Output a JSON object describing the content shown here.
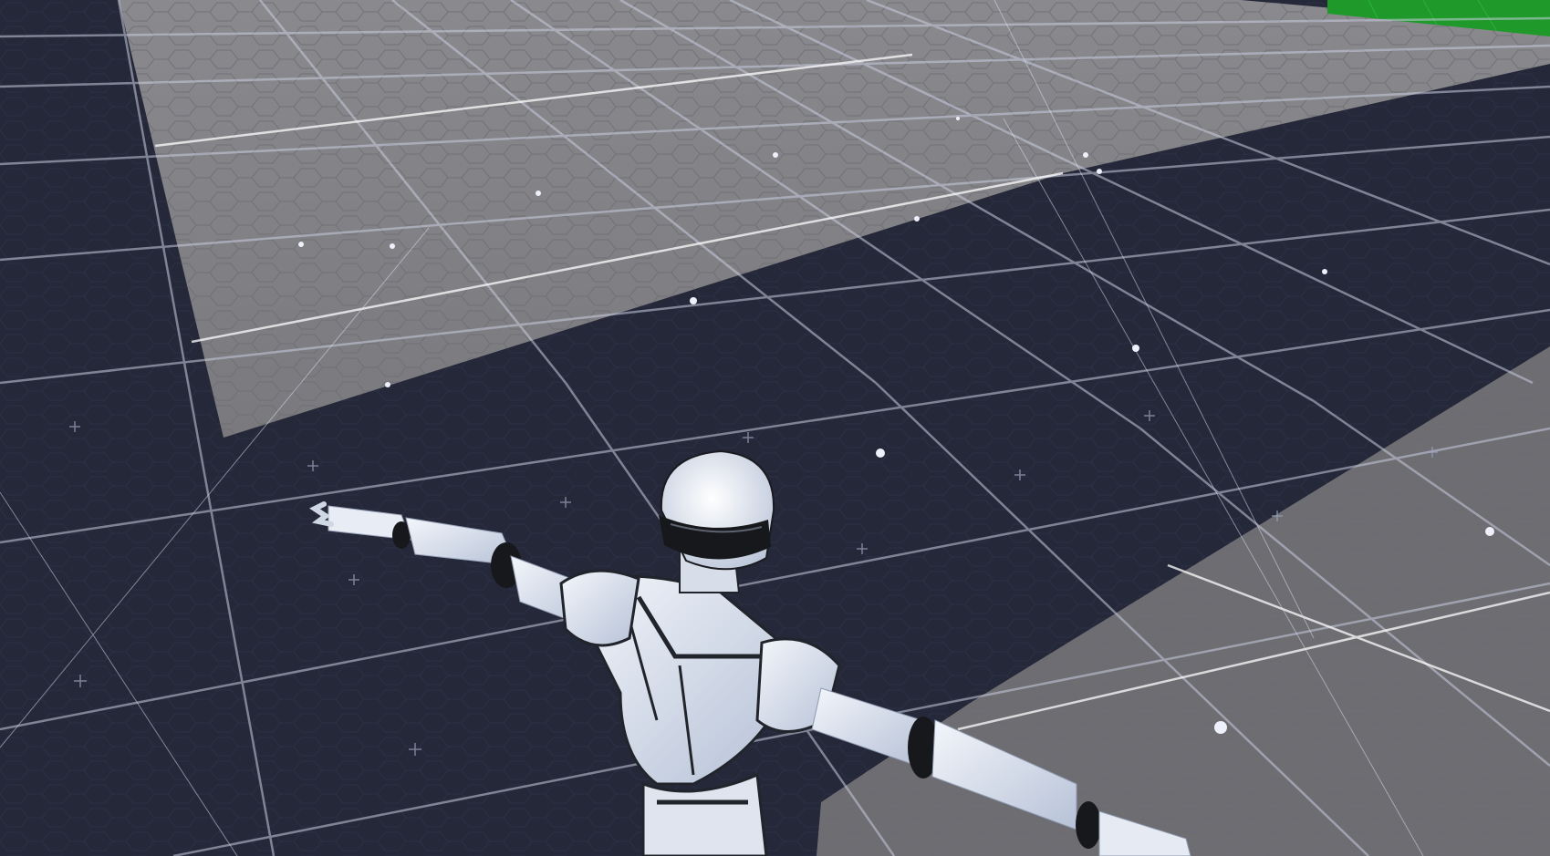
{
  "scene": {
    "description_visible_text": "",
    "colors": {
      "shadow_floor": "#262a3d",
      "lit_floor": "#76767b",
      "lit_floor_dark": "#6a6a6f",
      "grid_line": "#c8ccd8",
      "green_floor": "#1f9a2a",
      "robot_white": "#e9edf5",
      "robot_shade": "#b9c3d6",
      "robot_joint": "#17181c"
    },
    "objects": [
      {
        "name": "ground-grid-floor",
        "kind": "floor"
      },
      {
        "name": "light-patch-back",
        "kind": "lit-area"
      },
      {
        "name": "light-patch-front-right",
        "kind": "lit-area"
      },
      {
        "name": "green-floor-patch",
        "kind": "floor"
      },
      {
        "name": "robot-character",
        "kind": "character",
        "pose": "T-pose"
      }
    ]
  }
}
